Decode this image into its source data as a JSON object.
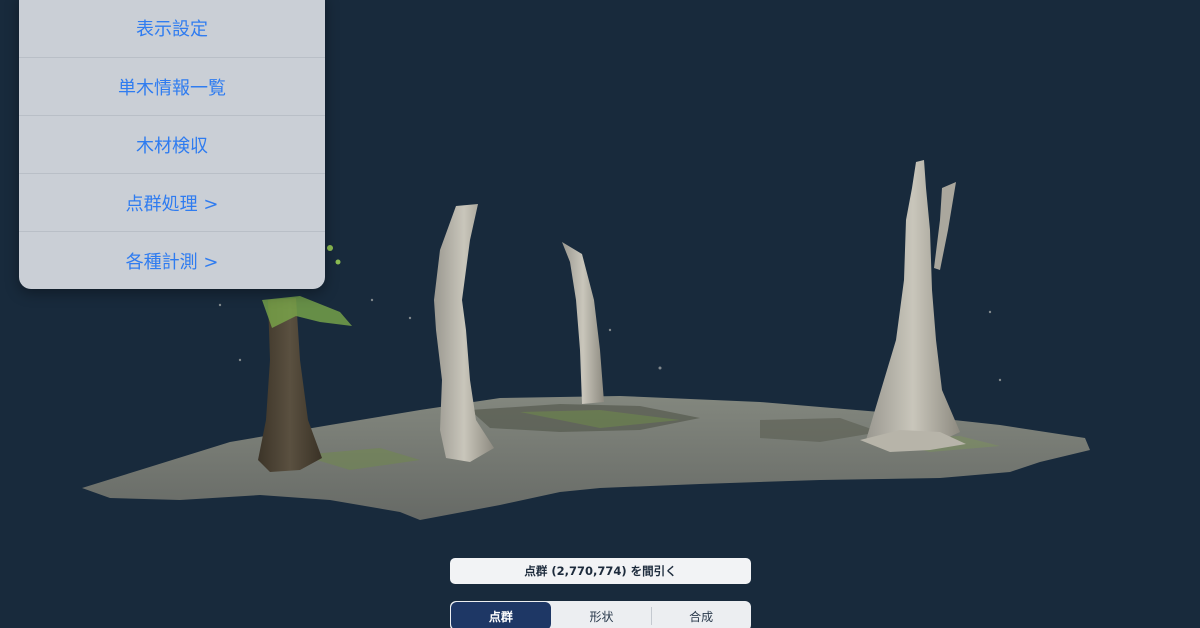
{
  "menu": {
    "items": [
      {
        "label": "表示設定"
      },
      {
        "label": "単木情報一覧"
      },
      {
        "label": "木材検収"
      },
      {
        "label": "点群処理 >"
      },
      {
        "label": "各種計測 >"
      }
    ]
  },
  "thin_button": {
    "label": "点群 (2,770,774) を間引く"
  },
  "segmented": {
    "items": [
      {
        "label": "点群",
        "selected": true
      },
      {
        "label": "形状",
        "selected": false
      },
      {
        "label": "合成",
        "selected": false
      }
    ]
  },
  "colors": {
    "background": "#182a3c",
    "menu_text": "#2f7cf0",
    "segment_active": "#1e3765"
  }
}
